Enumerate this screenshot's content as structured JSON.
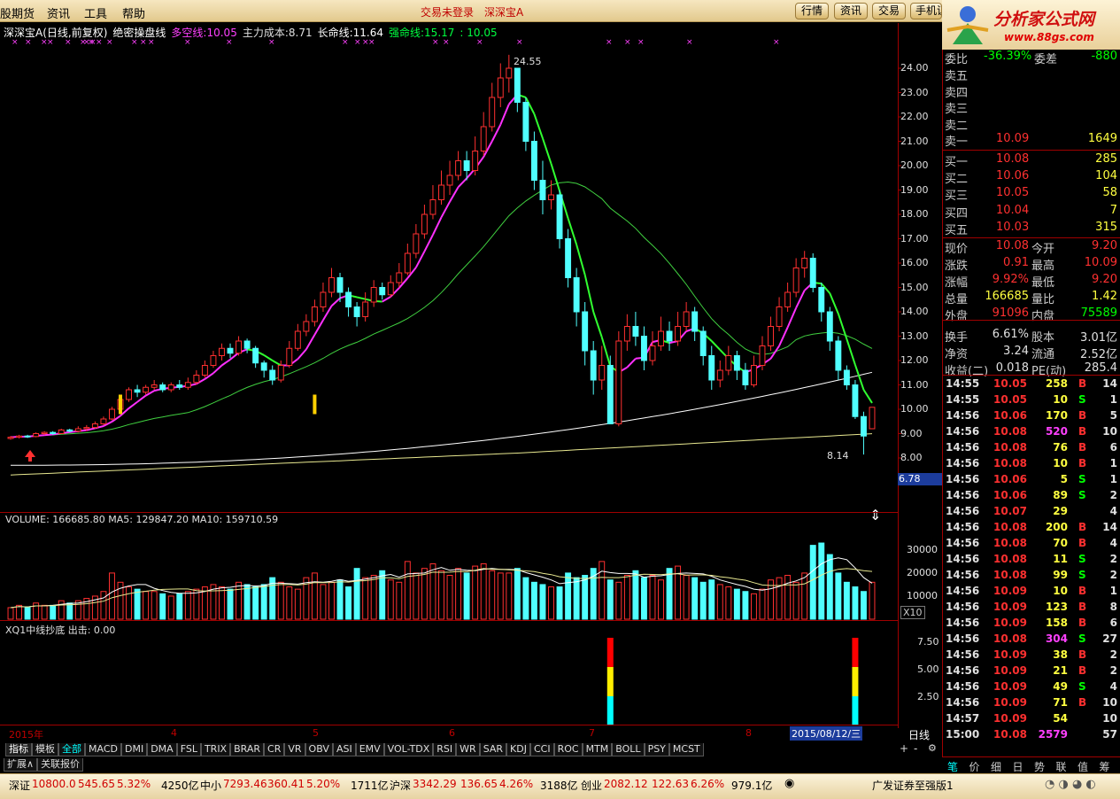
{
  "menubar": {
    "items": [
      "股期货",
      "资讯",
      "工具",
      "帮助"
    ],
    "center": [
      "交易未登录",
      "深深宝A"
    ],
    "buttons": [
      "行情",
      "资讯",
      "交易",
      "手机证"
    ]
  },
  "logo": {
    "brand": "分析家公式网",
    "url": "www.88gs.com"
  },
  "chart": {
    "name": "深深宝A",
    "mode": "(日线,前复权)",
    "indicator": "绝密操盘线",
    "duokong_label": "多空线:",
    "duokong": "10.05",
    "cost_label": "主力成本:",
    "cost": "8.71",
    "long_label": "长命线:",
    "long": "11.64",
    "strong_label": "强命线:",
    "strong": "15.17",
    "extra": ": 10.05",
    "high_label": "24.55",
    "low_label": "8.14",
    "cur_tag": "6.78",
    "hold_tag": "X10"
  },
  "price_axis": [
    "24.00",
    "23.00",
    "22.00",
    "21.00",
    "20.00",
    "19.00",
    "18.00",
    "17.00",
    "16.00",
    "15.00",
    "14.00",
    "13.00",
    "12.00",
    "11.00",
    "10.00",
    "9.00",
    "8.00"
  ],
  "volume": {
    "title": "VOLUME: 166685.80  MA5: 129847.20  MA10: 159710.59",
    "axis": [
      "30000",
      "20000",
      "10000"
    ]
  },
  "indicator2": {
    "title": "XQ1中线抄底  出击: 0.00",
    "axis": [
      "7.50",
      "5.00",
      "2.50"
    ]
  },
  "date_axis": {
    "labels": [
      "2015年",
      "4",
      "5",
      "6",
      "7",
      "8"
    ],
    "cursor": "2015/08/12/三",
    "period": "日线"
  },
  "tabs": [
    "指标",
    "模板",
    "全部",
    "MACD",
    "DMI",
    "DMA",
    "FSL",
    "TRIX",
    "BRAR",
    "CR",
    "VR",
    "OBV",
    "ASI",
    "EMV",
    "VOL-TDX",
    "RSI",
    "WR",
    "SAR",
    "KDJ",
    "CCI",
    "ROC",
    "MTM",
    "BOLL",
    "PSY",
    "MCST"
  ],
  "tabs2": [
    "扩展∧",
    "关联报价"
  ],
  "status": {
    "sz_label": "深证",
    "sz": "10800.0",
    "sz_chg": "545.65",
    "sz_pct": "5.32%",
    "sz_amt": "4250亿",
    "zx_label": "中小",
    "zx": "7293.46",
    "zx_chg": "360.41",
    "zx_pct": "5.20%",
    "zx_amt": "1711亿",
    "hs_label": "沪深",
    "hs": "3342.29",
    "hs_chg": "136.65",
    "hs_pct": "4.26%",
    "hs_amt": "3188亿",
    "cy_label": "创业",
    "cy": "2082.12",
    "cy_chg": "122.63",
    "cy_pct": "6.26%",
    "cy_amt": "979.1亿",
    "broker": "广发证券至强版1"
  },
  "panel": {
    "wei": {
      "label1": "委比",
      "v1": "-36.39%",
      "label2": "委差",
      "v2": "-880"
    },
    "sell": [
      {
        "label": "卖五",
        "price": "",
        "vol": ""
      },
      {
        "label": "卖四",
        "price": "",
        "vol": ""
      },
      {
        "label": "卖三",
        "price": "",
        "vol": ""
      },
      {
        "label": "卖二",
        "price": "",
        "vol": ""
      },
      {
        "label": "卖一",
        "price": "10.09",
        "vol": "1649"
      }
    ],
    "buy": [
      {
        "label": "买一",
        "price": "10.08",
        "vol": "285"
      },
      {
        "label": "买二",
        "price": "10.06",
        "vol": "104"
      },
      {
        "label": "买三",
        "price": "10.05",
        "vol": "58"
      },
      {
        "label": "买四",
        "price": "10.04",
        "vol": "7"
      },
      {
        "label": "买五",
        "price": "10.03",
        "vol": "315"
      }
    ],
    "stats": [
      {
        "l1": "现价",
        "v1": "10.08",
        "l2": "今开",
        "v2": "9.20"
      },
      {
        "l1": "涨跌",
        "v1": "0.91",
        "l2": "最高",
        "v2": "10.09"
      },
      {
        "l1": "涨幅",
        "v1": "9.92%",
        "l2": "最低",
        "v2": "9.20"
      },
      {
        "l1": "总量",
        "v1": "166685",
        "l2": "量比",
        "v2": "1.42"
      },
      {
        "l1": "外盘",
        "v1": "91096",
        "l2": "内盘",
        "v2": "75589"
      },
      {
        "l1": "换手",
        "v1": "6.61%",
        "l2": "股本",
        "v2": "3.01亿"
      },
      {
        "l1": "净资",
        "v1": "3.24",
        "l2": "流通",
        "v2": "2.52亿"
      },
      {
        "l1": "收益(二)",
        "v1": "0.018",
        "l2": "PE(动)",
        "v2": "285.4"
      }
    ],
    "ticks": [
      [
        "14:55",
        "10.05",
        "258",
        "B",
        "14"
      ],
      [
        "14:55",
        "10.05",
        "10",
        "S",
        "1"
      ],
      [
        "14:56",
        "10.06",
        "170",
        "B",
        "5"
      ],
      [
        "14:56",
        "10.08",
        "520",
        "B",
        "10"
      ],
      [
        "14:56",
        "10.08",
        "76",
        "B",
        "6"
      ],
      [
        "14:56",
        "10.08",
        "10",
        "B",
        "1"
      ],
      [
        "14:56",
        "10.06",
        "5",
        "S",
        "1"
      ],
      [
        "14:56",
        "10.06",
        "89",
        "S",
        "2"
      ],
      [
        "14:56",
        "10.07",
        "29",
        "",
        "4"
      ],
      [
        "14:56",
        "10.08",
        "200",
        "B",
        "14"
      ],
      [
        "14:56",
        "10.08",
        "70",
        "B",
        "4"
      ],
      [
        "14:56",
        "10.08",
        "11",
        "S",
        "2"
      ],
      [
        "14:56",
        "10.08",
        "99",
        "S",
        "2"
      ],
      [
        "14:56",
        "10.09",
        "10",
        "B",
        "1"
      ],
      [
        "14:56",
        "10.09",
        "123",
        "B",
        "8"
      ],
      [
        "14:56",
        "10.09",
        "158",
        "B",
        "6"
      ],
      [
        "14:56",
        "10.08",
        "304",
        "S",
        "27"
      ],
      [
        "14:56",
        "10.09",
        "38",
        "B",
        "2"
      ],
      [
        "14:56",
        "10.09",
        "21",
        "B",
        "2"
      ],
      [
        "14:56",
        "10.09",
        "49",
        "S",
        "4"
      ],
      [
        "14:56",
        "10.09",
        "71",
        "B",
        "10"
      ],
      [
        "14:57",
        "10.09",
        "54",
        "",
        "10"
      ],
      [
        "15:00",
        "10.08",
        "2579",
        "",
        "57"
      ]
    ],
    "bottom_tabs": [
      "笔",
      "价",
      "细",
      "日",
      "势",
      "联",
      "值",
      "筹"
    ]
  },
  "chart_data": {
    "type": "candlestick",
    "ylim": [
      7.8,
      24.6
    ],
    "candles": [
      [
        8.8,
        8.85,
        8.75,
        8.9
      ],
      [
        8.85,
        8.9,
        8.8,
        8.95
      ],
      [
        8.9,
        8.88,
        8.82,
        8.95
      ],
      [
        8.88,
        9.0,
        8.85,
        9.05
      ],
      [
        9.0,
        9.05,
        8.95,
        9.1
      ],
      [
        9.05,
        9.0,
        8.95,
        9.1
      ],
      [
        9.0,
        9.15,
        8.98,
        9.2
      ],
      [
        9.15,
        9.1,
        9.05,
        9.2
      ],
      [
        9.1,
        9.2,
        9.05,
        9.3
      ],
      [
        9.2,
        9.25,
        9.1,
        9.35
      ],
      [
        9.25,
        9.4,
        9.2,
        9.5
      ],
      [
        9.4,
        9.6,
        9.35,
        9.7
      ],
      [
        9.6,
        10.0,
        9.55,
        10.1
      ],
      [
        10.0,
        10.4,
        9.9,
        10.5
      ],
      [
        10.4,
        10.8,
        10.3,
        10.9
      ],
      [
        10.8,
        10.7,
        10.5,
        11.0
      ],
      [
        10.7,
        10.9,
        10.6,
        11.0
      ],
      [
        10.9,
        11.0,
        10.8,
        11.2
      ],
      [
        11.0,
        10.8,
        10.7,
        11.1
      ],
      [
        10.8,
        11.0,
        10.7,
        11.1
      ],
      [
        11.0,
        10.9,
        10.8,
        11.2
      ],
      [
        10.9,
        11.1,
        10.8,
        11.3
      ],
      [
        11.1,
        11.4,
        11.0,
        11.6
      ],
      [
        11.4,
        11.8,
        11.3,
        12.0
      ],
      [
        11.8,
        12.2,
        11.7,
        12.4
      ],
      [
        12.2,
        12.5,
        12.0,
        12.7
      ],
      [
        12.5,
        12.3,
        12.1,
        12.7
      ],
      [
        12.3,
        12.8,
        12.2,
        13.0
      ],
      [
        12.8,
        12.5,
        12.3,
        12.9
      ],
      [
        12.5,
        11.9,
        11.7,
        12.6
      ],
      [
        11.9,
        11.6,
        11.3,
        12.0
      ],
      [
        11.6,
        11.2,
        11.0,
        11.8
      ],
      [
        11.2,
        11.8,
        11.1,
        12.0
      ],
      [
        11.8,
        12.5,
        11.7,
        12.8
      ],
      [
        12.5,
        13.2,
        12.4,
        13.5
      ],
      [
        13.2,
        13.6,
        13.0,
        13.9
      ],
      [
        13.6,
        14.2,
        13.4,
        14.5
      ],
      [
        14.2,
        14.8,
        14.0,
        15.2
      ],
      [
        14.8,
        15.4,
        14.6,
        15.8
      ],
      [
        15.4,
        14.8,
        14.4,
        15.6
      ],
      [
        14.8,
        14.2,
        13.8,
        15.0
      ],
      [
        14.2,
        13.8,
        13.4,
        14.4
      ],
      [
        13.8,
        14.4,
        13.6,
        14.8
      ],
      [
        14.4,
        15.0,
        14.2,
        15.3
      ],
      [
        15.0,
        14.7,
        14.5,
        15.2
      ],
      [
        14.7,
        15.2,
        14.6,
        15.5
      ],
      [
        15.2,
        15.6,
        15.0,
        16.0
      ],
      [
        15.6,
        16.4,
        15.5,
        16.8
      ],
      [
        16.4,
        17.2,
        16.2,
        17.6
      ],
      [
        17.2,
        18.0,
        17.0,
        18.4
      ],
      [
        18.0,
        18.6,
        17.8,
        19.2
      ],
      [
        18.6,
        19.2,
        18.4,
        19.8
      ],
      [
        19.2,
        19.6,
        18.8,
        20.2
      ],
      [
        19.6,
        20.2,
        19.4,
        20.6
      ],
      [
        20.2,
        19.8,
        19.4,
        20.6
      ],
      [
        19.8,
        20.6,
        19.6,
        21.2
      ],
      [
        20.6,
        21.6,
        20.4,
        22.2
      ],
      [
        21.6,
        22.8,
        21.4,
        23.4
      ],
      [
        22.8,
        23.6,
        22.4,
        24.2
      ],
      [
        23.6,
        24.0,
        23.0,
        24.55
      ],
      [
        24.0,
        22.6,
        22.2,
        24.0
      ],
      [
        22.6,
        21.0,
        20.6,
        22.8
      ],
      [
        21.0,
        19.4,
        19.0,
        21.4
      ],
      [
        19.4,
        18.6,
        18.0,
        20.2
      ],
      [
        18.6,
        18.8,
        18.2,
        19.4
      ],
      [
        18.8,
        17.0,
        16.6,
        19.0
      ],
      [
        17.0,
        15.4,
        15.0,
        17.4
      ],
      [
        15.4,
        14.0,
        13.4,
        15.8
      ],
      [
        14.0,
        12.4,
        11.8,
        14.4
      ],
      [
        12.4,
        11.2,
        10.6,
        12.8
      ],
      [
        11.2,
        11.8,
        10.8,
        12.6
      ],
      [
        11.8,
        9.4,
        9.4,
        12.2
      ],
      [
        9.4,
        12.8,
        9.3,
        13.2
      ],
      [
        12.8,
        13.4,
        12.4,
        13.9
      ],
      [
        13.4,
        13.0,
        12.6,
        14.0
      ],
      [
        13.0,
        12.0,
        11.6,
        13.4
      ],
      [
        12.0,
        12.6,
        11.8,
        13.2
      ],
      [
        12.6,
        13.2,
        12.4,
        13.8
      ],
      [
        13.2,
        12.8,
        12.4,
        13.6
      ],
      [
        12.8,
        13.4,
        12.6,
        14.0
      ],
      [
        13.4,
        14.0,
        13.2,
        14.4
      ],
      [
        14.0,
        13.2,
        12.8,
        14.2
      ],
      [
        13.2,
        12.2,
        11.8,
        13.4
      ],
      [
        12.2,
        11.2,
        10.8,
        12.6
      ],
      [
        11.2,
        11.6,
        10.9,
        12.0
      ],
      [
        11.6,
        12.2,
        11.4,
        12.6
      ],
      [
        12.2,
        11.6,
        11.2,
        12.4
      ],
      [
        11.6,
        11.0,
        10.8,
        11.9
      ],
      [
        11.0,
        11.8,
        10.9,
        12.2
      ],
      [
        11.8,
        12.6,
        11.6,
        13.0
      ],
      [
        12.6,
        13.4,
        12.4,
        13.8
      ],
      [
        13.4,
        14.2,
        13.2,
        14.6
      ],
      [
        14.2,
        14.8,
        14.0,
        15.2
      ],
      [
        14.8,
        15.8,
        14.6,
        16.2
      ],
      [
        15.8,
        16.2,
        15.4,
        16.5
      ],
      [
        16.2,
        15.0,
        14.8,
        16.4
      ],
      [
        15.0,
        14.0,
        13.6,
        15.2
      ],
      [
        14.0,
        12.8,
        12.4,
        14.2
      ],
      [
        12.8,
        11.6,
        11.2,
        13.0
      ],
      [
        11.6,
        11.0,
        10.8,
        11.8
      ],
      [
        11.0,
        9.7,
        9.6,
        11.2
      ],
      [
        9.7,
        8.9,
        8.14,
        9.9
      ],
      [
        9.2,
        10.08,
        9.2,
        10.09
      ]
    ],
    "volumes": [
      5,
      6,
      5,
      7,
      6,
      6,
      8,
      7,
      8,
      9,
      10,
      12,
      20,
      16,
      14,
      13,
      12,
      12,
      11,
      10,
      11,
      12,
      13,
      14,
      15,
      14,
      13,
      16,
      15,
      14,
      15,
      18,
      16,
      14,
      13,
      18,
      20,
      15,
      16,
      17,
      14,
      22,
      18,
      19,
      21,
      17,
      16,
      25,
      20,
      22,
      24,
      21,
      19,
      22,
      20,
      23,
      24,
      21,
      20,
      20,
      22,
      18,
      16,
      15,
      14,
      14,
      20,
      18,
      19,
      22,
      25,
      17,
      16,
      19,
      21,
      18,
      19,
      17,
      22,
      23,
      19,
      18,
      16,
      17,
      15,
      14,
      13,
      12,
      11,
      13,
      17,
      18,
      19,
      16,
      20,
      32,
      33,
      28,
      20,
      16,
      14,
      12,
      16
    ],
    "volume_ylim": [
      0,
      38000
    ],
    "signal_bars": [
      71,
      100
    ]
  }
}
